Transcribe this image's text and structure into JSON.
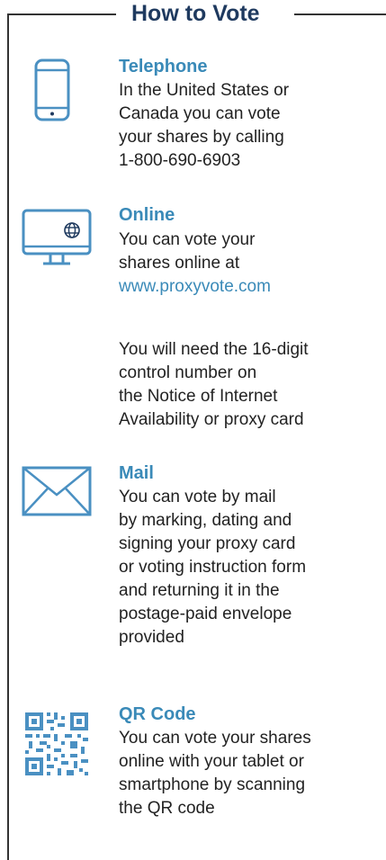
{
  "title": "How to Vote",
  "sections": [
    {
      "heading": "Telephone",
      "icon": "phone-icon",
      "lines": [
        "In the United States or",
        "Canada you can vote",
        "your shares by calling",
        "1-800-690-6903"
      ]
    },
    {
      "heading": "Online",
      "icon": "computer-globe-icon",
      "lines": [
        "You can vote your",
        "shares online at"
      ],
      "link": "www.proxyvote.com",
      "note_lines": [
        "You will need the 16-digit",
        "control number on",
        "the Notice of Internet",
        "Availability or proxy card"
      ]
    },
    {
      "heading": "Mail",
      "icon": "envelope-icon",
      "lines": [
        "You can vote by mail",
        "by marking, dating and",
        "signing your proxy card",
        "or voting instruction form",
        "and returning it in the",
        "postage-paid envelope",
        "provided"
      ]
    },
    {
      "heading": "QR Code",
      "icon": "qr-code-icon",
      "lines": [
        "You can vote your shares",
        "online with your tablet or",
        "smartphone by scanning",
        "the QR code"
      ]
    }
  ],
  "colors": {
    "heading": "#3a8ab8",
    "title": "#1f3a5f",
    "icon": "#4a90c2"
  }
}
